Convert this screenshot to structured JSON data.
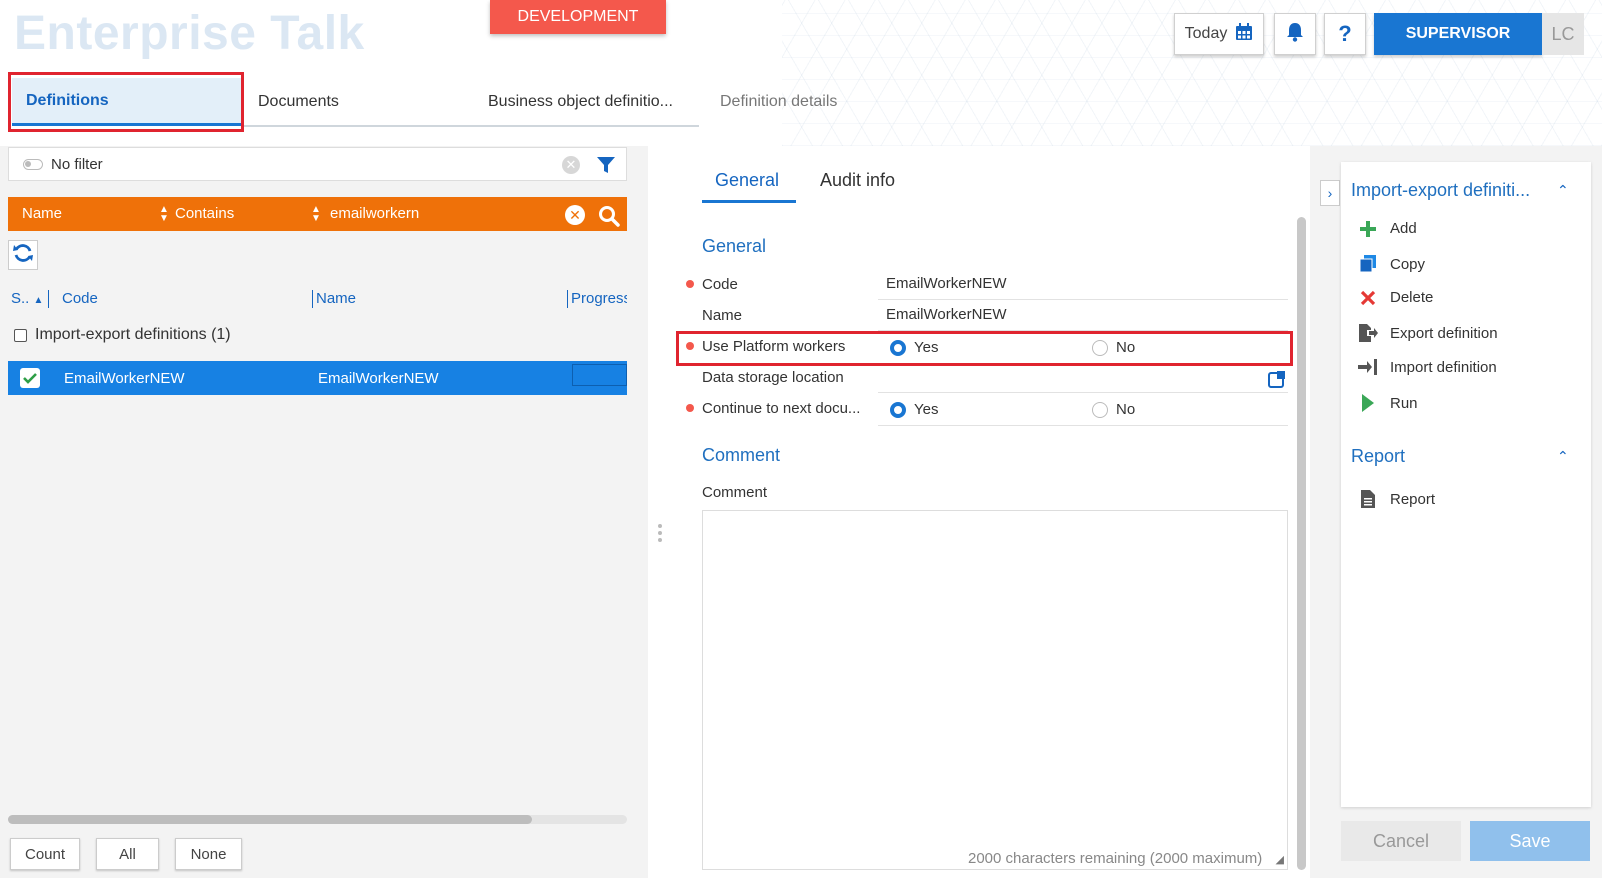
{
  "app": {
    "title": "Enterprise Talk",
    "environment": "DEVELOPMENT"
  },
  "header": {
    "today_label": "Today",
    "help_label": "?",
    "user_role": "SUPERVISOR",
    "user_initials": "LC"
  },
  "tabs": [
    {
      "label": "Definitions"
    },
    {
      "label": "Documents"
    },
    {
      "label": "Business object definitio..."
    },
    {
      "label": "Definition details"
    }
  ],
  "filter": {
    "label": "No filter"
  },
  "search": {
    "field": "Name",
    "operator": "Contains",
    "value": "emailworkern"
  },
  "grid": {
    "columns": [
      "S..",
      "Code",
      "Name",
      "Progress"
    ],
    "group_label": "Import-export definitions (1)",
    "rows": [
      {
        "code": "EmailWorkerNEW",
        "name": "EmailWorkerNEW"
      }
    ],
    "footer_buttons": [
      "Count",
      "All",
      "None"
    ]
  },
  "detail": {
    "tabs": [
      "General",
      "Audit info"
    ],
    "section_general": "General",
    "fields": {
      "code": {
        "label": "Code",
        "value": "EmailWorkerNEW"
      },
      "name": {
        "label": "Name",
        "value": "EmailWorkerNEW"
      },
      "use_platform_workers": {
        "label": "Use Platform workers",
        "yes": "Yes",
        "no": "No",
        "selected": "Yes"
      },
      "data_storage": {
        "label": "Data storage location",
        "value": ""
      },
      "continue_next": {
        "label": "Continue to next docu...",
        "yes": "Yes",
        "no": "No",
        "selected": "Yes"
      }
    },
    "section_comment": "Comment",
    "comment_label": "Comment",
    "chars_remaining": "2000 characters remaining (2000 maximum)"
  },
  "actions": {
    "section_title": "Import-export definiti...",
    "items": [
      "Add",
      "Copy",
      "Delete",
      "Export definition",
      "Import definition",
      "Run"
    ],
    "report_title": "Report",
    "report_items": [
      "Report"
    ]
  },
  "buttons": {
    "cancel": "Cancel",
    "save": "Save"
  },
  "colors": {
    "accent": "#1976d2",
    "search_bar": "#ef7109",
    "env_badge": "#f4584c",
    "highlight": "#e0242f"
  }
}
